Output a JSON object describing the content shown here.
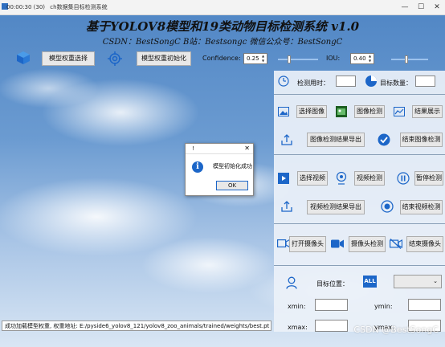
{
  "window": {
    "title": "ch数据集目标检测系统",
    "title_prefix": "00:00:30 (30)",
    "controls": {
      "minimize": "—",
      "maximize": "☐",
      "close": "✕"
    }
  },
  "header": {
    "title": "基于YOLOV8模型和19类动物目标检测系统 v1.0",
    "subtitle": "CSDN：BestSongC   B站：Bestsongc   微信公众号：BestSongC"
  },
  "toolbar": {
    "model_select_label": "模型权重选择",
    "model_init_label": "模型权重初始化",
    "confidence_label": "Confidence:",
    "confidence_value": "0.25",
    "iou_label": "IOU:",
    "iou_value": "0.40"
  },
  "sliders": {
    "confidence_level": 0.25,
    "iou_level": 0.4
  },
  "stats": {
    "detect_time_label": "检测用时：",
    "target_count_label": "目标数量："
  },
  "image_section": {
    "select_label": "选择图像",
    "detect_label": "图像检测",
    "show_label": "结果展示",
    "export_label": "图像检测结果导出",
    "end_label": "结束图像检测"
  },
  "video_section": {
    "select_label": "选择视频",
    "detect_label": "视频检测",
    "pause_label": "暂停检测",
    "export_label": "视频检测结果导出",
    "end_label": "结束视频检测"
  },
  "camera_section": {
    "open_label": "打开摄像头",
    "detect_label": "摄像头检测",
    "end_label": "结束摄像头"
  },
  "position": {
    "label": "目标位置：",
    "all_badge": "ALL",
    "xmin": "xmin:",
    "ymin": "ymin:",
    "xmax": "xmax:",
    "ymax": "ymax:"
  },
  "dialog": {
    "title": "!",
    "message": "模型初始化成功",
    "ok_label": "OK"
  },
  "status_bar": {
    "text": "成功加载模型权重, 权重地址: E:/pyside6_yolov8_121/yolov8_zoo_animals/trained/weights/best.pt"
  },
  "watermark": "CSDN @BestSongC",
  "colors": {
    "accent": "#1c66c8",
    "panel": "#ebf1f8",
    "sky_top": "#4f85c4"
  }
}
